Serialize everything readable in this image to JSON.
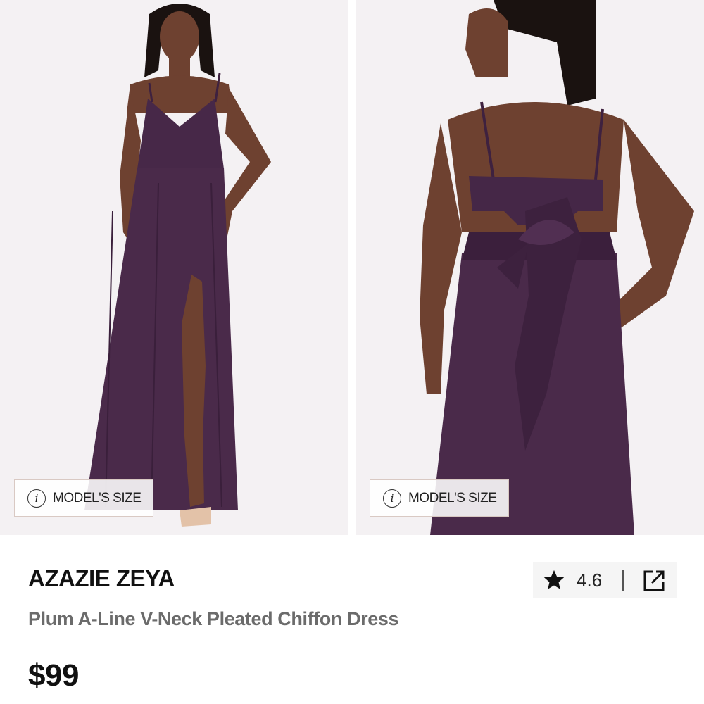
{
  "product": {
    "brand": "AZAZIE ZEYA",
    "name": "Plum A-Line V-Neck Pleated Chiffon Dress",
    "price": "$99",
    "rating": "4.6"
  },
  "gallery": {
    "model_size_label": "MODEL'S SIZE",
    "info_glyph": "i"
  },
  "icons": {
    "rating": "star-icon",
    "share": "external-link-icon",
    "info": "info-icon"
  },
  "colors": {
    "dress_plum": "#4a2a4a",
    "skin": "#7a4a35",
    "background": "#f4f1f3",
    "rating_box": "#f5f5f5",
    "product_name": "#6b6b6b"
  }
}
